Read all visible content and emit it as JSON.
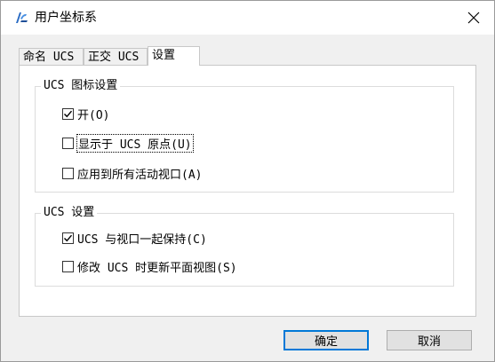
{
  "window": {
    "title": "用户坐标系",
    "close_symbol": "✕"
  },
  "tabs": [
    {
      "label": "命名 UCS",
      "active": false
    },
    {
      "label": "正交 UCS",
      "active": false
    },
    {
      "label": "设置",
      "active": true
    }
  ],
  "ucs_icon_settings": {
    "title": "UCS 图标设置",
    "options": [
      {
        "label": "开(O)",
        "checked": true
      },
      {
        "label": "显示于 UCS 原点(U)",
        "checked": false
      },
      {
        "label": "应用到所有活动视口(A)",
        "checked": false
      }
    ]
  },
  "ucs_settings": {
    "title": "UCS 设置",
    "options": [
      {
        "label": "UCS 与视口一起保持(C)",
        "checked": true
      },
      {
        "label": "修改 UCS 时更新平面视图(S)",
        "checked": false
      }
    ]
  },
  "buttons": {
    "ok": "确定",
    "cancel": "取消"
  },
  "colors": {
    "accent": "#0078d7",
    "check": "#000000"
  }
}
